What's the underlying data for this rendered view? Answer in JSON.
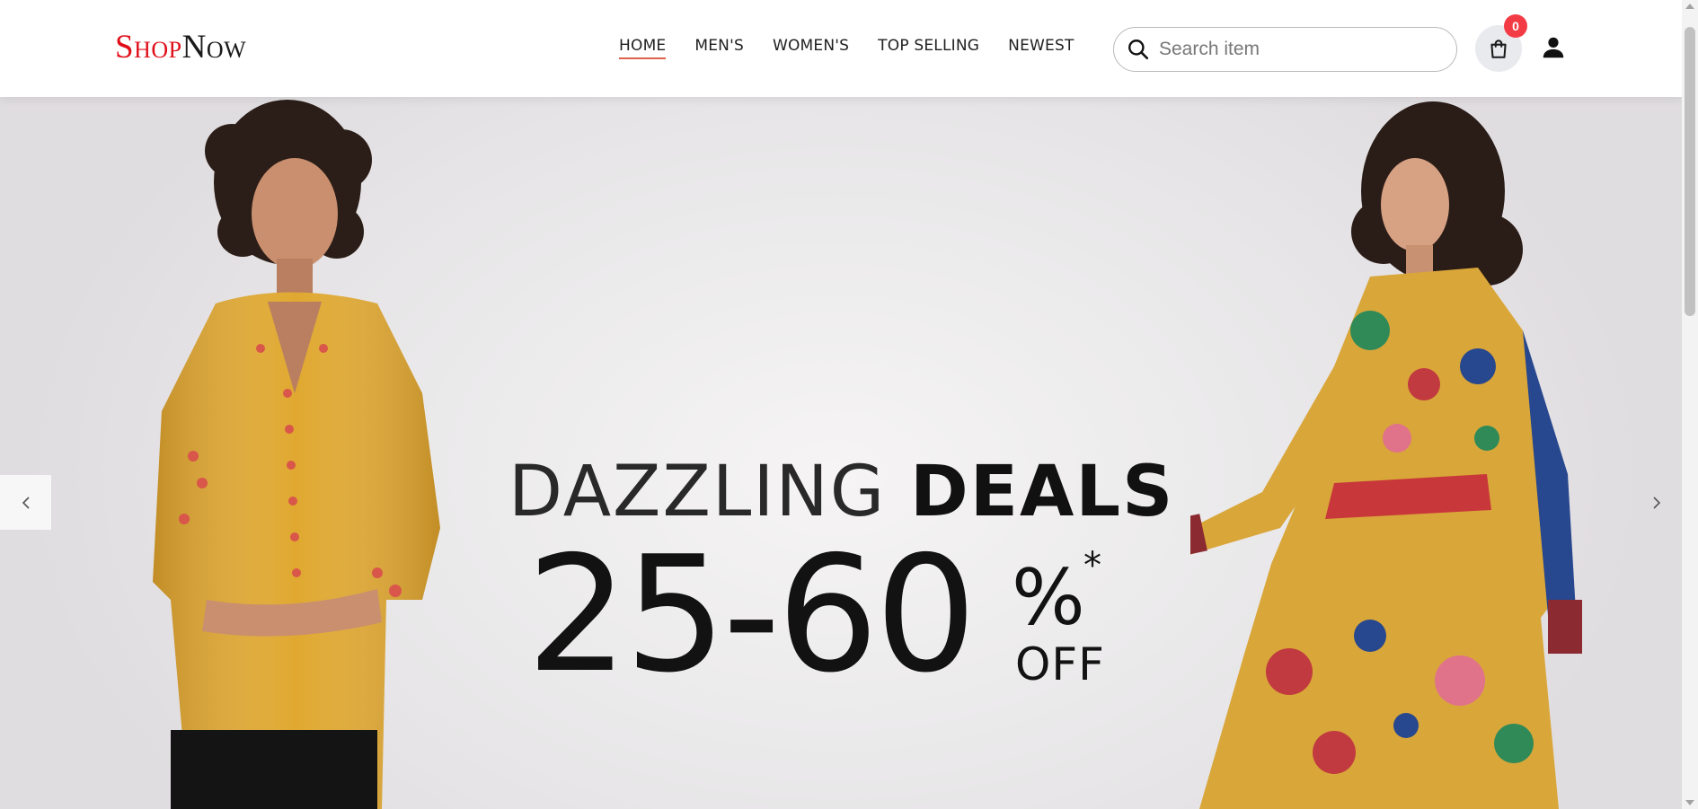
{
  "brand": {
    "part_a": "Shop",
    "part_b": "Now",
    "accent_color": "#e0101b"
  },
  "nav": {
    "items": [
      {
        "label": "HOME",
        "active": true
      },
      {
        "label": "MEN'S",
        "active": false
      },
      {
        "label": "WOMEN'S",
        "active": false
      },
      {
        "label": "TOP SELLING",
        "active": false
      },
      {
        "label": "NEWEST",
        "active": false
      }
    ]
  },
  "search": {
    "placeholder": "Search item",
    "value": "",
    "icon": "search-icon"
  },
  "cart": {
    "count": "0",
    "icon": "shopping-bag-icon",
    "badge_color": "#f33b45"
  },
  "user": {
    "icon": "user-icon"
  },
  "hero": {
    "headline_light": "DAZZLING",
    "headline_bold": "DEALS",
    "discount": "25-60",
    "percent": "%",
    "asterisk": "*",
    "off": "OFF",
    "prev_icon": "chevron-left-icon",
    "next_icon": "chevron-right-icon"
  }
}
